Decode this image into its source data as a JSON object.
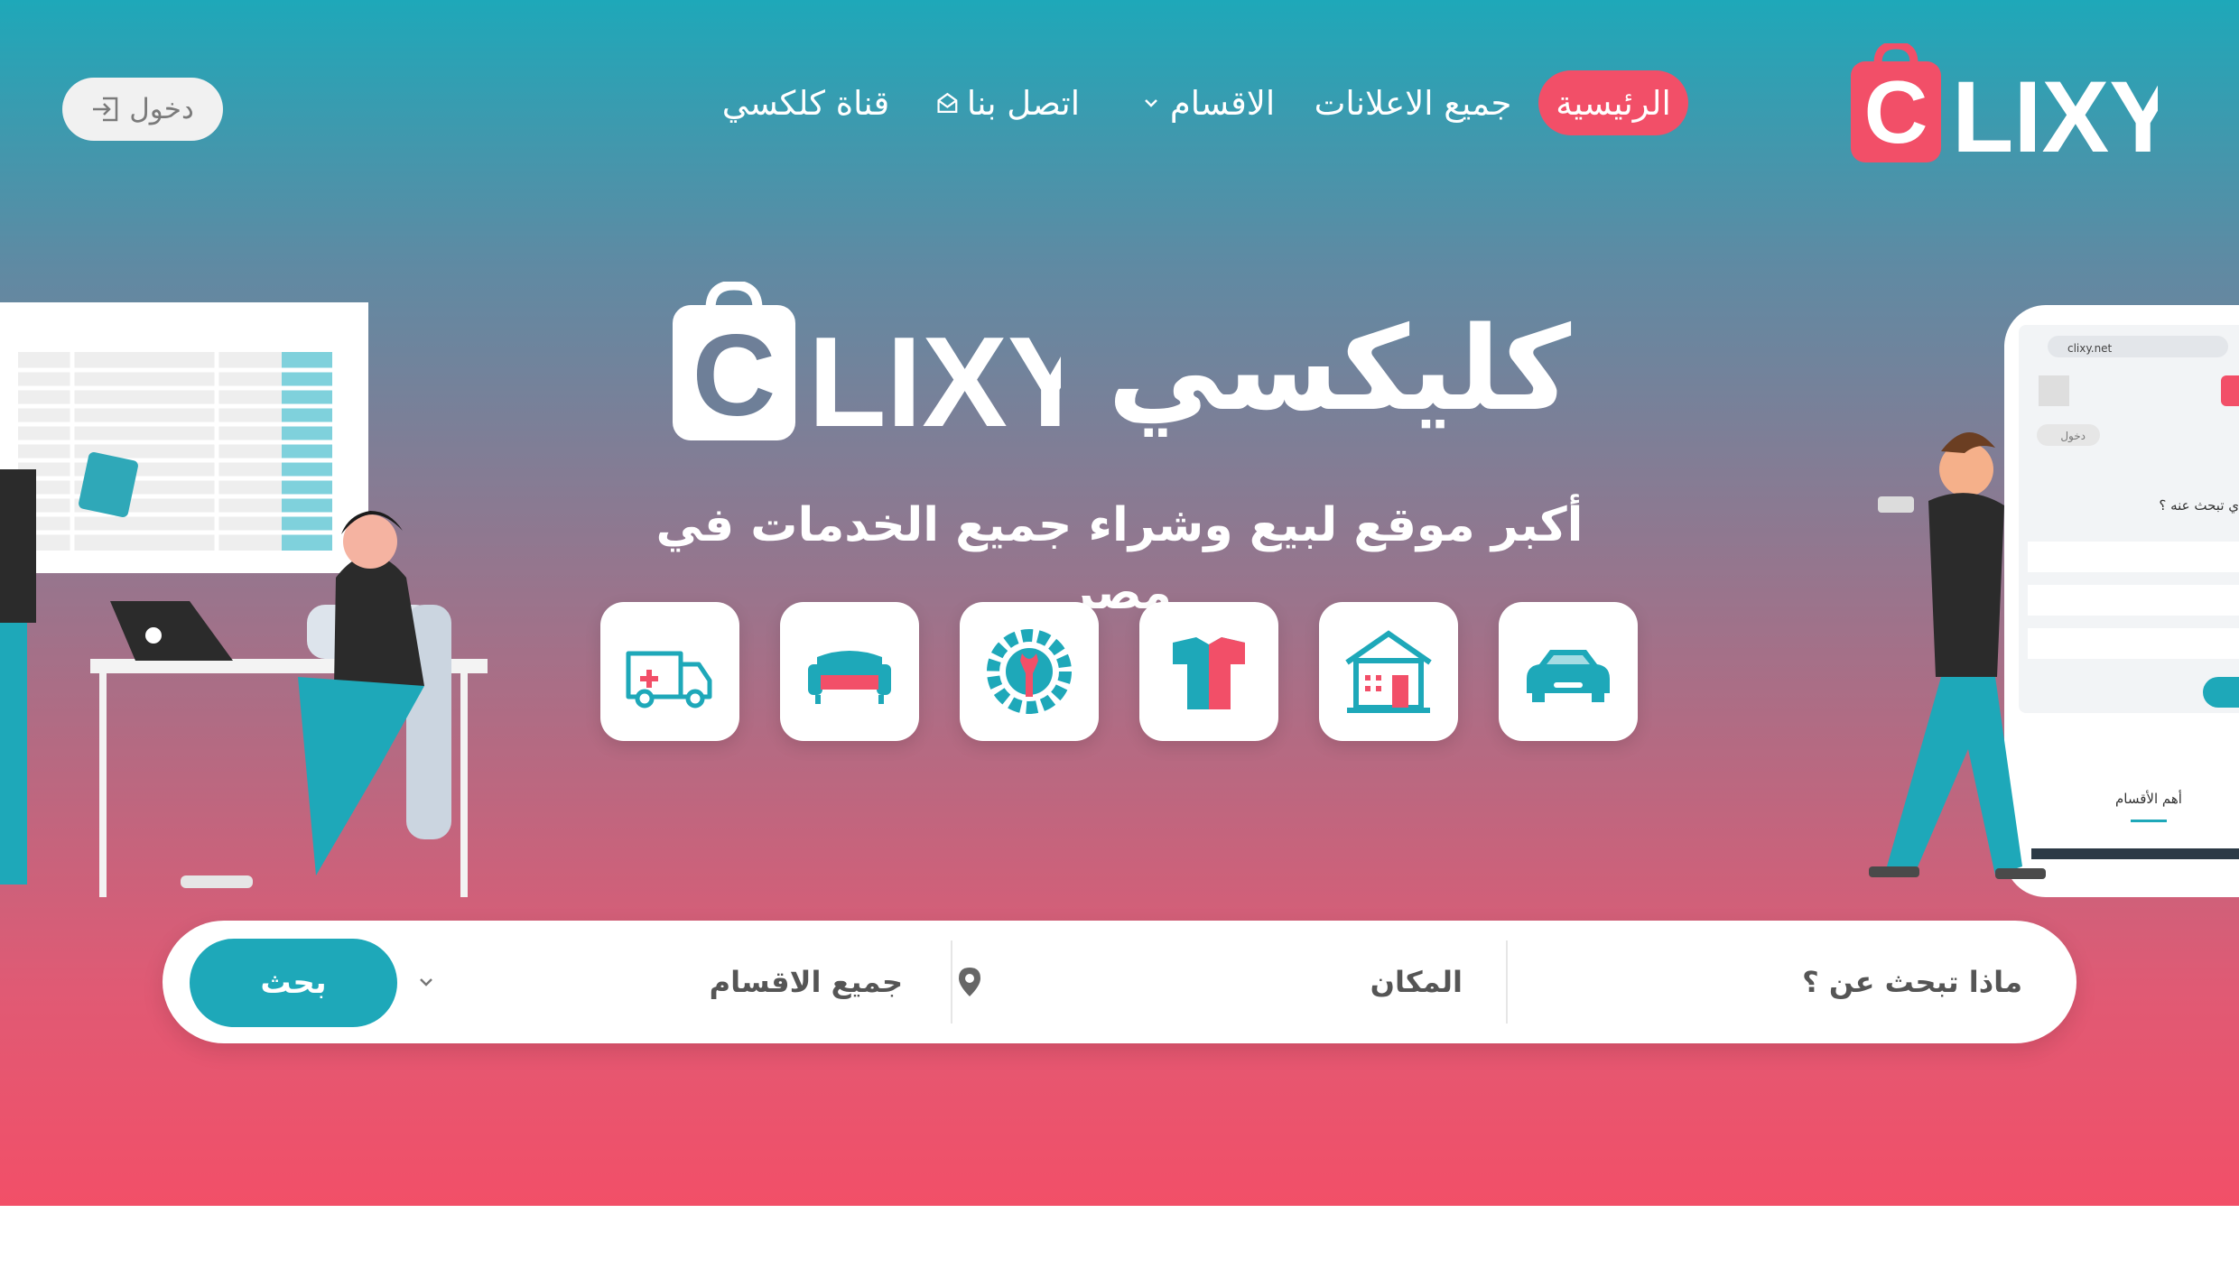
{
  "nav": {
    "logo_text": "LIXY",
    "logo_letter": "C",
    "home": "الرئيسية",
    "all_ads": "جميع الاعلانات",
    "categories": "الاقسام",
    "contact": "اتصل بنا",
    "channel": "قناة كلكسي",
    "login": "دخول"
  },
  "hero": {
    "brand_latin": "LIXY",
    "brand_letter": "C",
    "brand_arabic": "كليكسي",
    "tagline": "أكبر موقع لبيع وشراء جميع الخدمات في مصر",
    "category_icons": [
      "ambulance-icon",
      "sofa-icon",
      "repair-icon",
      "clothing-icon",
      "real-estate-icon",
      "car-icon"
    ]
  },
  "search": {
    "what_placeholder": "ماذا تبحث عن ؟",
    "place_placeholder": "المكان",
    "category_value": "جميع الاقسام",
    "button": "بحث"
  },
  "phone_mock": {
    "url": "clixy.net",
    "login": "دخول",
    "question": "ي تبحث عنه ؟",
    "section_title": "أهم الأقسام"
  },
  "colors": {
    "brand_red": "#f24f68",
    "brand_teal": "#1ea8b9"
  }
}
